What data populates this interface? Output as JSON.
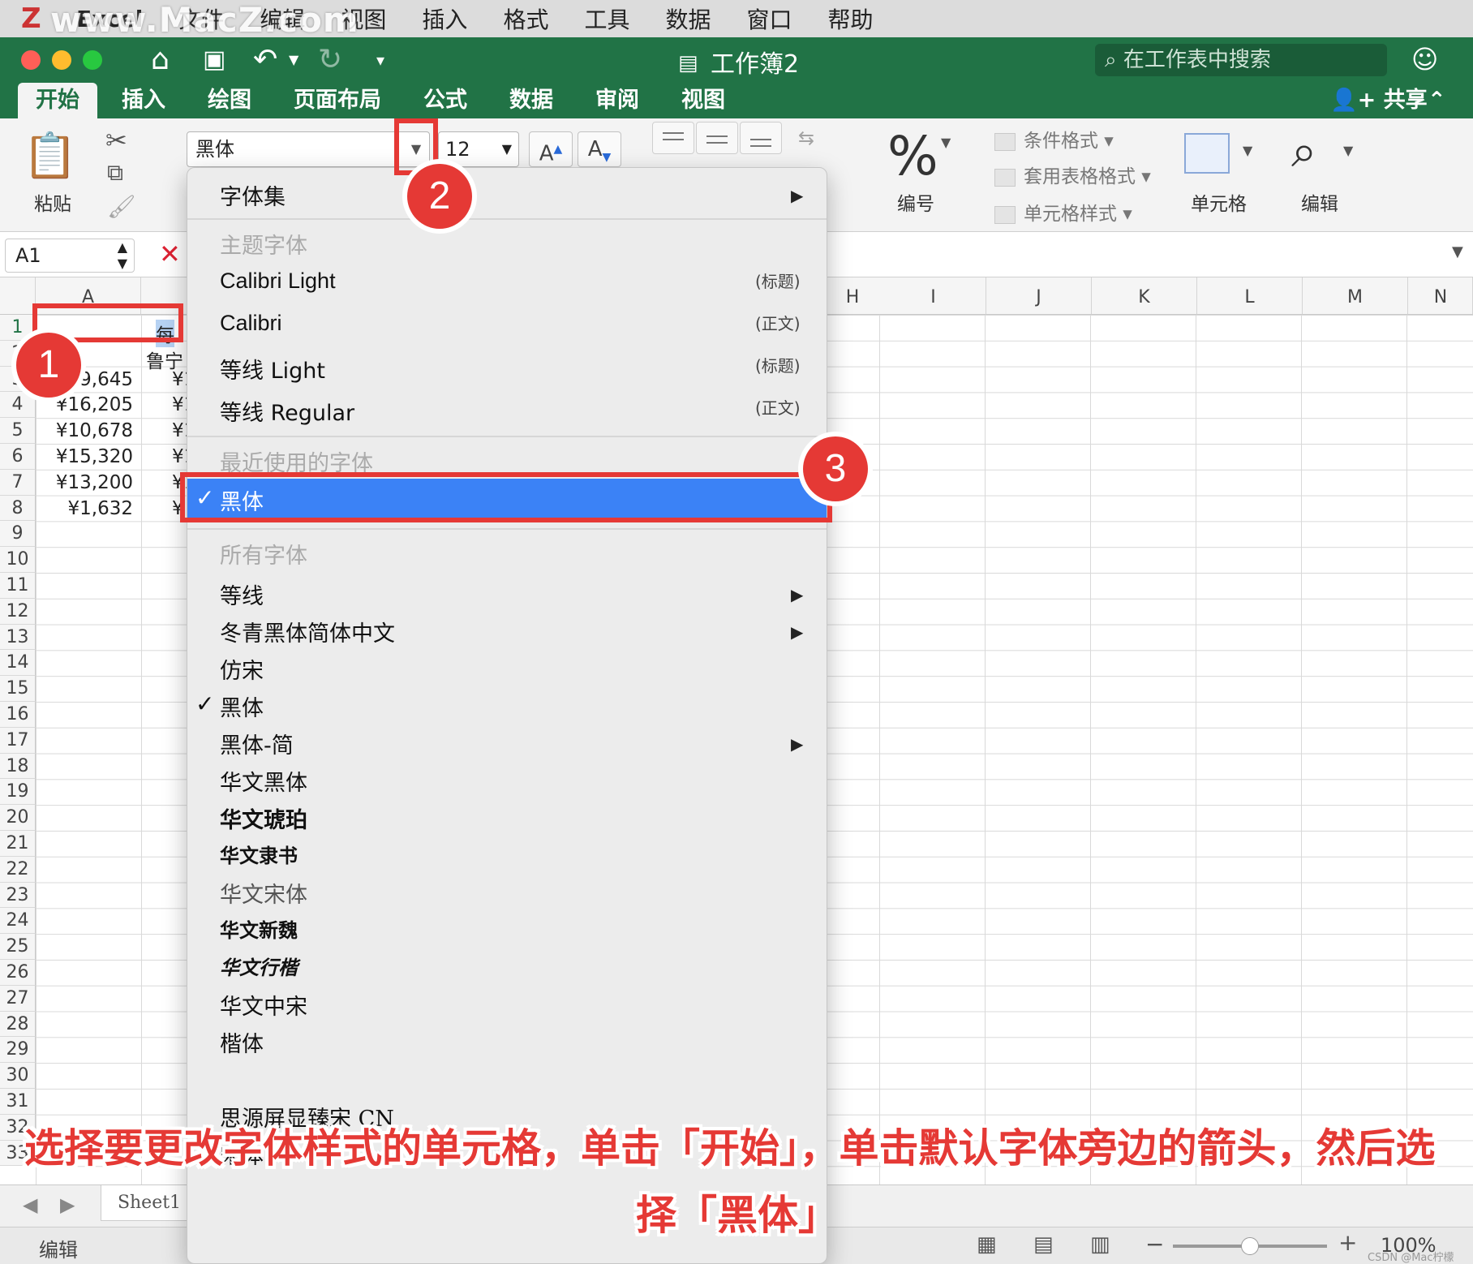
{
  "menubar": {
    "watermark": "www.MacZ.com",
    "app": "Excel",
    "items": [
      "文件",
      "编辑",
      "视图",
      "插入",
      "格式",
      "工具",
      "数据",
      "窗口",
      "帮助"
    ]
  },
  "titlebar": {
    "title": "工作簿2",
    "search_placeholder": "在工作表中搜索"
  },
  "tabs": {
    "items": [
      "开始",
      "插入",
      "绘图",
      "页面布局",
      "公式",
      "数据",
      "审阅",
      "视图"
    ],
    "share": "共享"
  },
  "ribbon": {
    "paste_label": "粘贴",
    "font_name": "黑体",
    "font_size": "12",
    "grow_label": "A",
    "shrink_label": "A",
    "number_symbol": "%",
    "number_label": "编号",
    "cond_format": "条件格式",
    "table_format": "套用表格格式",
    "cell_style": "单元格样式",
    "cells_label": "单元格",
    "edit_label": "编辑"
  },
  "formula": {
    "cell_ref": "A1"
  },
  "grid": {
    "col_a": "A",
    "cols_right": [
      "H",
      "I",
      "J",
      "K",
      "L",
      "M",
      "N"
    ],
    "rows": [
      "1",
      "2",
      "3",
      "4",
      "5",
      "6",
      "7",
      "8",
      "9",
      "10",
      "11",
      "12",
      "13",
      "14",
      "15",
      "16",
      "17",
      "18",
      "19",
      "20",
      "21",
      "22",
      "23",
      "24",
      "25",
      "26",
      "27",
      "28",
      "29",
      "30",
      "31",
      "32",
      "33"
    ],
    "a_values": [
      "¥19,645",
      "¥16,205",
      "¥10,678",
      "¥15,320",
      "¥13,200",
      "¥1,632"
    ],
    "b_values": [
      "¥1",
      "¥1",
      "¥1",
      "¥1",
      "¥1",
      "¥"
    ],
    "b1": "每",
    "b2": "鲁宁"
  },
  "dropdown": {
    "font_set": "字体集",
    "theme_fonts": "主题字体",
    "theme_items": [
      {
        "name": "Calibri Light",
        "tag": "(标题)"
      },
      {
        "name": "Calibri",
        "tag": "(正文)"
      },
      {
        "name": "等线 Light",
        "tag": "(标题)"
      },
      {
        "name": "等线 Regular",
        "tag": "(正文)"
      }
    ],
    "recent_fonts": "最近使用的字体",
    "recent_selected": "黑体",
    "all_fonts": "所有字体",
    "all_items": [
      "等线",
      "冬青黑体简体中文",
      "仿宋",
      "黑体",
      "黑体-简",
      "华文黑体",
      "华文琥珀",
      "华文隶书",
      "华文宋体",
      "华文新魏",
      "华文行楷",
      "华文中宋",
      "楷体",
      "思源屏显臻宋 CN",
      "宋体"
    ],
    "checkmark": "✓",
    "submenu_arrow": "▶"
  },
  "sheetbar": {
    "sheet_name": "Sheet1"
  },
  "statusbar": {
    "mode": "编辑",
    "zoom": "100%",
    "credit": "CSDN @Mac柠檬"
  },
  "annotations": {
    "badge1": "1",
    "badge2": "2",
    "badge3": "3",
    "caption_line1": "选择要更改字体样式的单元格，单击「开始」，单击默认字体旁边的箭头，然后选",
    "caption_line2": "择「黑体」"
  },
  "colors": {
    "excel_green": "#217346",
    "annotation_red": "#e53935",
    "selection_blue": "#3b82f6"
  }
}
